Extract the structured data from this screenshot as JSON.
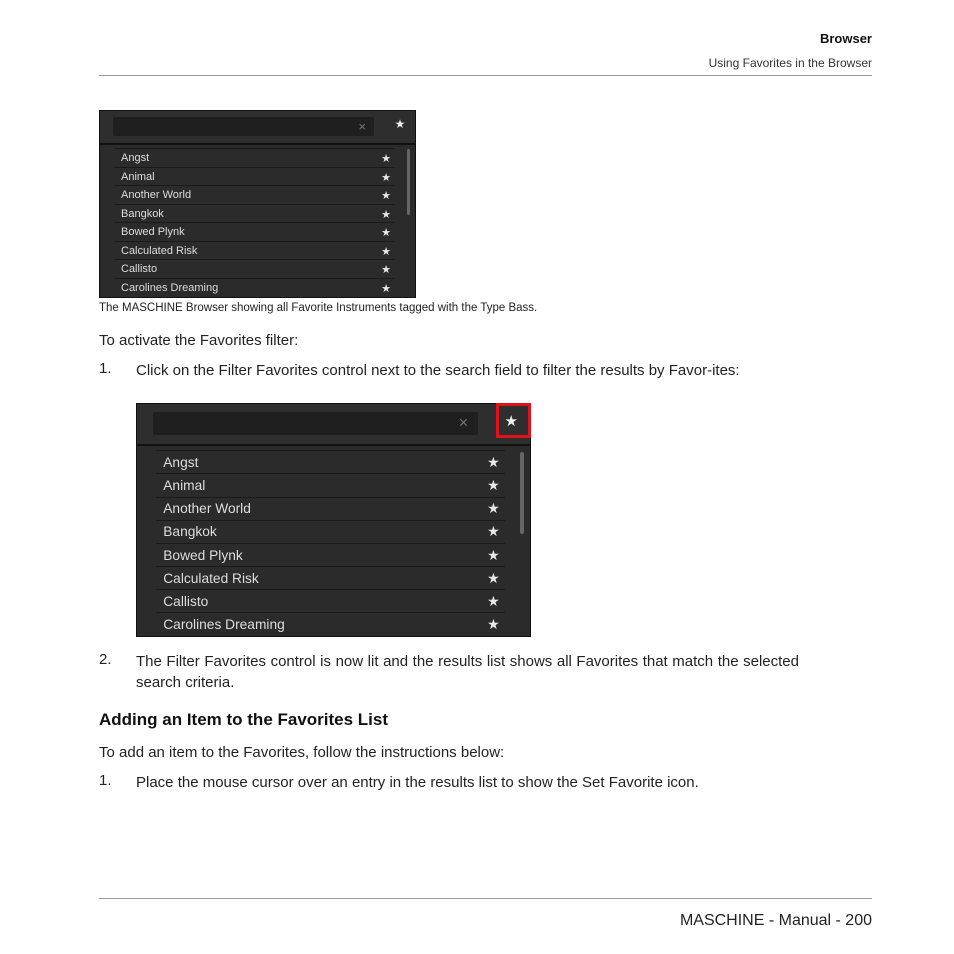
{
  "header": {
    "chapter": "Browser",
    "section": "Using Favorites in the Browser"
  },
  "browser": {
    "clear_icon": "×",
    "filter_icon": "★",
    "items": [
      "Angst",
      "Animal",
      "Another World",
      "Bangkok",
      "Bowed Plynk",
      "Calculated Risk",
      "Callisto",
      "Carolines Dreaming"
    ],
    "favorite_icon": "★"
  },
  "caption": "The MASCHINE Browser showing all Favorite Instruments tagged with the Type Bass.",
  "intro": "To activate the Favorites filter:",
  "steps": [
    {
      "num": "1.",
      "text": "Click on the Filter Favorites control next to the search field to filter the results by Favor-ites:"
    },
    {
      "num": "2.",
      "text": "The Filter Favorites control is now lit and the results list shows all Favorites that match the selected search criteria."
    }
  ],
  "section_heading": "Adding an Item to the Favorites List",
  "add_intro": "To add an item to the Favorites, follow the instructions below:",
  "add_steps": [
    {
      "num": "1.",
      "text": "Place the mouse cursor over an entry in the results list to show the Set Favorite icon."
    }
  ],
  "footer": "MASCHINE - Manual - 200",
  "colors": {
    "highlight": "#e0121c"
  }
}
